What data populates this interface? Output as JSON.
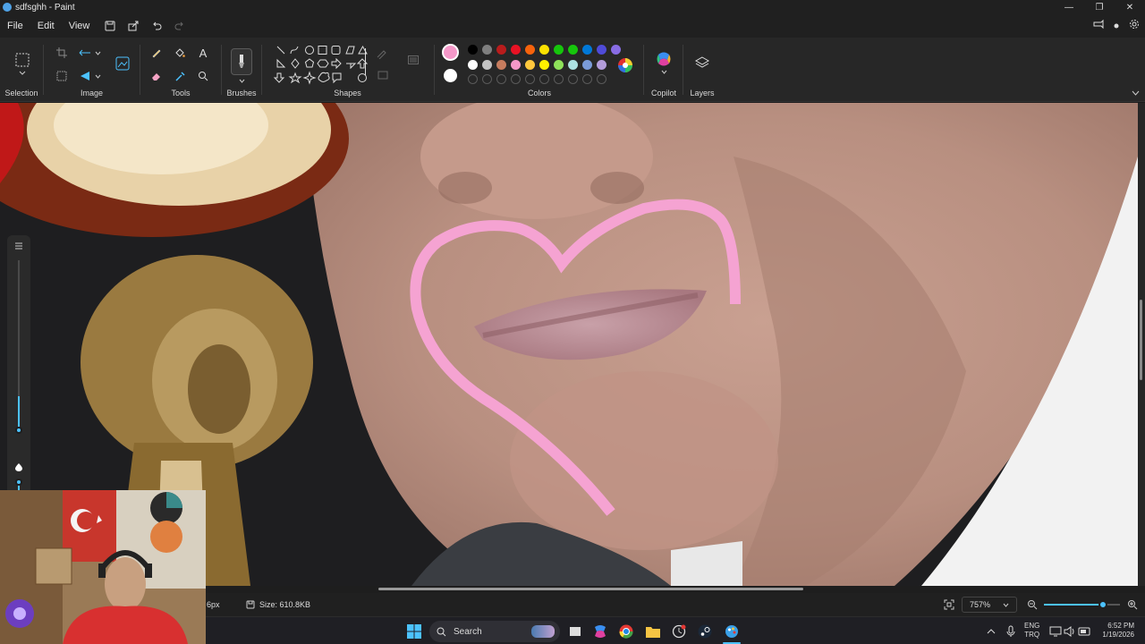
{
  "window": {
    "title": "sdfsghh - Paint",
    "minimize_glyph": "—",
    "maximize_glyph": "❐",
    "close_glyph": "✕"
  },
  "menu": {
    "items": [
      "File",
      "Edit",
      "View"
    ]
  },
  "ribbon": {
    "groups": {
      "selection": "Selection",
      "image": "Image",
      "tools": "Tools",
      "brushes": "Brushes",
      "shapes": "Shapes",
      "colors": "Colors",
      "copilot": "Copilot",
      "layers": "Layers"
    },
    "primary_color": "#f598c9",
    "secondary_color": "#ffffff",
    "palette_row1": [
      "#000000",
      "#7f7f7f",
      "#b91c1c",
      "#e81224",
      "#f7630c",
      "#fce100",
      "#16c60c",
      "#16c60c",
      "#0078d7",
      "#4f4bd8",
      "#886ce4"
    ],
    "palette_row2": [
      "#ffffff",
      "#c3c3c3",
      "#c67c5e",
      "#f598c9",
      "#ffc83d",
      "#fff100",
      "#8ee15a",
      "#ade1e1",
      "#7a9bd8",
      "#b39ddb"
    ]
  },
  "status": {
    "brush_size": "6px",
    "size_label": "Size: 610.8KB",
    "zoom": "757%",
    "zoom_level": 0.78
  },
  "taskbar": {
    "search_placeholder": "Search",
    "lang": "ENG",
    "layout": "TRQ",
    "time": "6:52 PM",
    "date": "1/19/2026"
  },
  "canvas": {
    "stroke_color": "#f5a3d2"
  }
}
